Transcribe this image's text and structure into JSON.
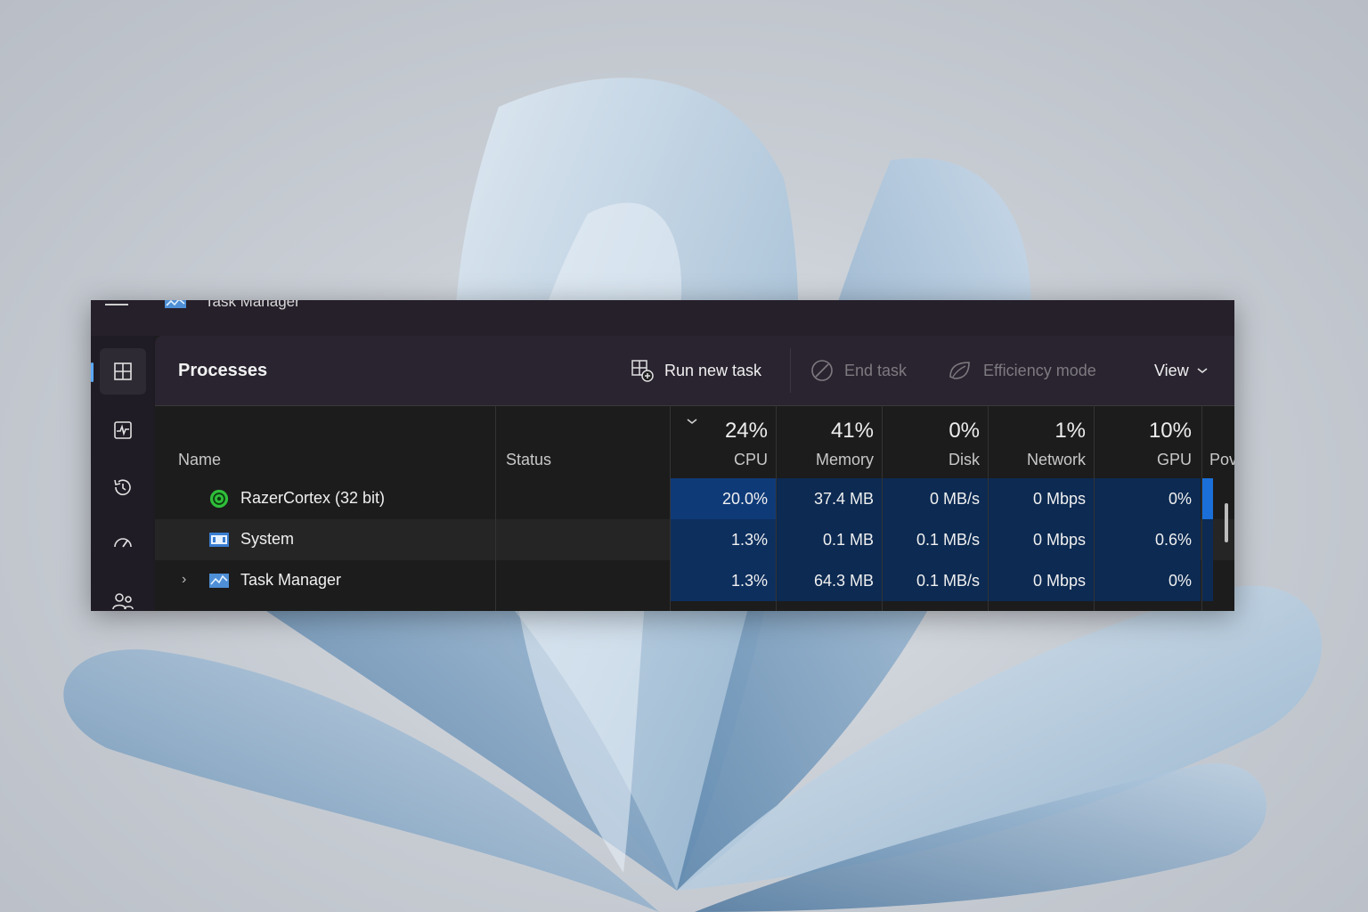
{
  "window": {
    "title": "Task Manager"
  },
  "page": {
    "title": "Processes"
  },
  "toolbar": {
    "run_new_task": "Run new task",
    "end_task": "End task",
    "efficiency_mode": "Efficiency mode",
    "view": "View"
  },
  "sidebar": {
    "items": [
      {
        "icon": "processes-icon"
      },
      {
        "icon": "performance-icon"
      },
      {
        "icon": "app-history-icon"
      },
      {
        "icon": "startup-apps-icon"
      },
      {
        "icon": "users-icon"
      }
    ]
  },
  "columns": {
    "name": "Name",
    "status": "Status",
    "cpu": {
      "pct": "24%",
      "label": "CPU"
    },
    "memory": {
      "pct": "41%",
      "label": "Memory"
    },
    "disk": {
      "pct": "0%",
      "label": "Disk"
    },
    "network": {
      "pct": "1%",
      "label": "Network"
    },
    "gpu": {
      "pct": "10%",
      "label": "GPU"
    },
    "power": {
      "label": "Pov"
    }
  },
  "rows": [
    {
      "name": "RazerCortex (32 bit)",
      "status": "",
      "cpu": "20.0%",
      "memory": "37.4 MB",
      "disk": "0 MB/s",
      "network": "0 Mbps",
      "gpu": "0%",
      "icon": "razer-cortex-icon"
    },
    {
      "name": "System",
      "status": "",
      "cpu": "1.3%",
      "memory": "0.1 MB",
      "disk": "0.1 MB/s",
      "network": "0 Mbps",
      "gpu": "0.6%",
      "icon": "system-icon"
    },
    {
      "name": "Task Manager",
      "status": "",
      "cpu": "1.3%",
      "memory": "64.3 MB",
      "disk": "0.1 MB/s",
      "network": "0 Mbps",
      "gpu": "0%",
      "icon": "task-manager-icon"
    }
  ],
  "colors": {
    "cpu_heat_high": "#0f3a78",
    "heat_low": "#0c2a52",
    "accent": "#5aa9ff"
  }
}
